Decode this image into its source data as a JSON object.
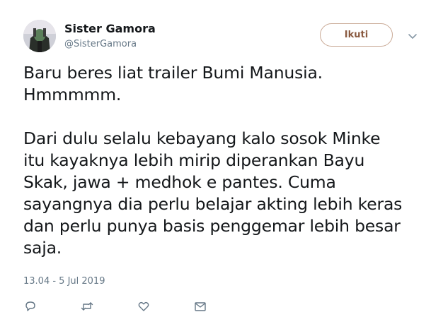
{
  "user": {
    "display_name": "Sister Gamora",
    "handle": "@SisterGamora"
  },
  "follow_button": {
    "label": "Ikuti"
  },
  "tweet": {
    "paragraph_1": "Baru beres liat trailer Bumi Manusia.\nHmmmmm.",
    "paragraph_2": "Dari dulu selalu kebayang kalo sosok Minke\nitu kayaknya lebih mirip diperankan Bayu\nSkak, jawa + medhok e pantes. Cuma\nsayangnya dia perlu belajar akting lebih keras\ndan perlu punya basis penggemar lebih besar\nsaja.",
    "timestamp": "13.04 - 5 Jul 2019"
  },
  "icons": {
    "avatar": "avatar-image",
    "caret": "chevron-down-icon",
    "reply": "reply-icon",
    "retweet": "retweet-icon",
    "like": "heart-icon",
    "dm": "envelope-icon"
  },
  "colors": {
    "accent": "#8a5a40",
    "muted": "#657786",
    "text": "#14171a"
  }
}
